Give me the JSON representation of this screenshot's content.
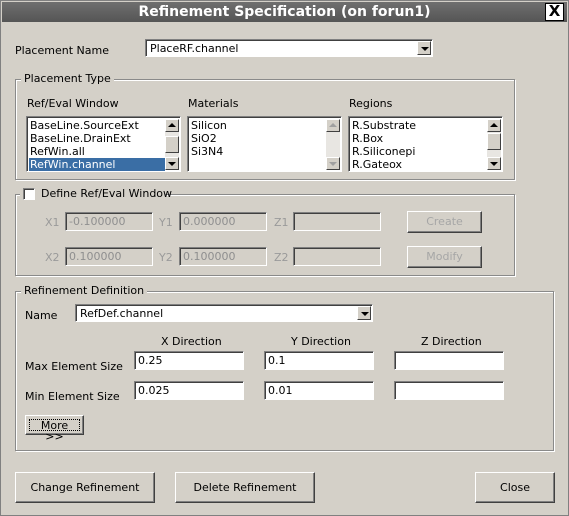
{
  "window": {
    "title": "Refinement Specification (on forun1)",
    "close_label": "X"
  },
  "placement_name": {
    "label": "Placement Name",
    "value": "PlaceRF.channel"
  },
  "placement_type": {
    "legend": "Placement Type",
    "ref_eval_window": {
      "header": "Ref/Eval Window",
      "items": [
        "BaseLine.SourceExt",
        "BaseLine.DrainExt",
        "RefWin.all",
        "RefWin.channel"
      ],
      "selected": "RefWin.channel"
    },
    "materials": {
      "header": "Materials",
      "items": [
        "Silicon",
        "SiO2",
        "Si3N4"
      ]
    },
    "regions": {
      "header": "Regions",
      "items": [
        "R.Substrate",
        "R.Box",
        "R.Siliconepi",
        "R.Gateox"
      ]
    }
  },
  "define_window": {
    "label": "Define Ref/Eval Window",
    "checked": false,
    "x1_label": "X1",
    "x1_value": "-0.100000",
    "y1_label": "Y1",
    "y1_value": "0.000000",
    "z1_label": "Z1",
    "z1_value": "",
    "x2_label": "X2",
    "x2_value": "0.100000",
    "y2_label": "Y2",
    "y2_value": "0.100000",
    "z2_label": "Z2",
    "z2_value": "",
    "create_label": "Create",
    "modify_label": "Modify"
  },
  "refinement_definition": {
    "legend": "Refinement Definition",
    "name_label": "Name",
    "name_value": "RefDef.channel",
    "x_header": "X Direction",
    "y_header": "Y Direction",
    "z_header": "Z Direction",
    "max_label": "Max Element Size",
    "max_x": "0.25",
    "max_y": "0.1",
    "max_z": "",
    "min_label": "Min Element Size",
    "min_x": "0.025",
    "min_y": "0.01",
    "min_z": "",
    "more_label": "More >>"
  },
  "buttons": {
    "change": "Change Refinement",
    "delete": "Delete Refinement",
    "close": "Close"
  },
  "colors": {
    "background": "#d4d0c8",
    "titlebar": "#606060",
    "selection": "#3a6ea5"
  }
}
